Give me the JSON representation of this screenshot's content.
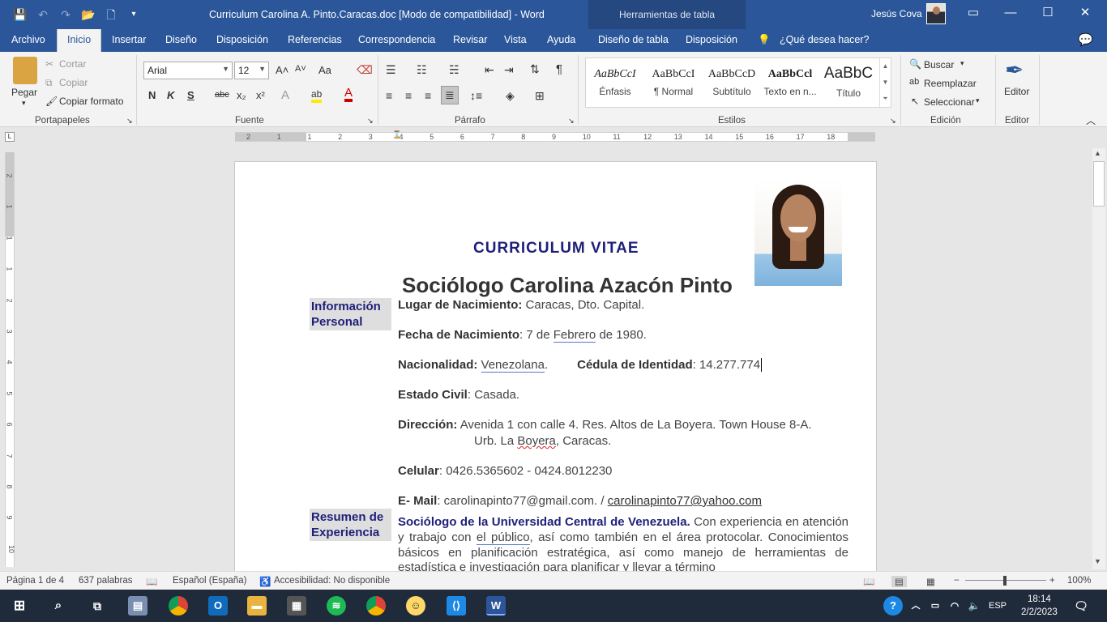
{
  "titlebar": {
    "doc_title": "Curriculum Carolina A. Pinto.Caracas.doc [Modo de compatibilidad]  -  Word",
    "table_tools": "Herramientas de tabla",
    "user": "Jesús Cova",
    "qat": {
      "save": "💾",
      "undo": "↶",
      "redo": "↷",
      "open": "📂",
      "new": "🗋",
      "more": "▾"
    }
  },
  "menu": {
    "tabs": [
      "Archivo",
      "Inicio",
      "Insertar",
      "Diseño",
      "Disposición",
      "Referencias",
      "Correspondencia",
      "Revisar",
      "Vista",
      "Ayuda",
      "Diseño de tabla",
      "Disposición",
      "¿Qué desea hacer?"
    ]
  },
  "ribbon": {
    "clipboard": {
      "label": "Portapapeles",
      "paste": "Pegar",
      "cut": "Cortar",
      "copy": "Copiar",
      "format_painter": "Copiar formato"
    },
    "font": {
      "label": "Fuente",
      "family": "Arial",
      "size": "12",
      "bold": "N",
      "italic": "K",
      "underline": "S",
      "strike": "abc",
      "sub": "x₂",
      "sup": "x²",
      "grow": "A˄",
      "shrink": "A˅",
      "case": "Aa",
      "effects": "A",
      "highlight": "ab",
      "color": "A"
    },
    "paragraph": {
      "label": "Párrafo"
    },
    "styles": {
      "label": "Estilos",
      "items": [
        {
          "sample": "AaBbCcI",
          "name": "Énfasis"
        },
        {
          "sample": "AaBbCcI",
          "name": "¶ Normal"
        },
        {
          "sample": "AaBbCcD",
          "name": "Subtítulo"
        },
        {
          "sample": "AaBbCcl",
          "name": "Texto en n..."
        },
        {
          "sample": "AaBbC",
          "name": "Título"
        }
      ]
    },
    "editing": {
      "label": "Edición",
      "find": "Buscar",
      "replace": "Reemplazar",
      "select": "Seleccionar"
    },
    "editor": {
      "label": "Editor",
      "button": "Editor"
    }
  },
  "ruler": {
    "h_ticks": [
      "2",
      "1",
      "1",
      "2",
      "3",
      "4",
      "5",
      "6",
      "7",
      "8",
      "9",
      "10",
      "11",
      "12",
      "13",
      "14",
      "15",
      "16",
      "17",
      "18"
    ],
    "v_ticks": [
      "2",
      "1",
      "1",
      "1",
      "2",
      "3",
      "4",
      "5",
      "6",
      "7",
      "8",
      "9",
      "10"
    ]
  },
  "document": {
    "cv_title": "CURRICULUM VITAE",
    "name": "Sociólogo Carolina Azacón Pinto",
    "section_personal": "Información Personal",
    "section_summary": "Resumen de Experiencia",
    "birthplace": {
      "label": "Lugar de Nacimiento:",
      "value": " Caracas, Dto. Capital."
    },
    "birthdate": {
      "label": "Fecha de Nacimiento",
      "pre": ": 7 de ",
      "month": "Febrero",
      "post": " de 1980."
    },
    "nationality": {
      "label": "Nacionalidad:",
      "value": "Venezolana",
      "id_label": "Cédula de Identidad",
      "id_value": ": 14.277.774"
    },
    "civil": {
      "label": "Estado Civil",
      "value": ":  Casada."
    },
    "address": {
      "label": "Dirección:",
      "line1": " Avenida 1 con calle 4. Res. Altos de La Boyera. Town House 8-A.",
      "line2_pre": "Urb. La ",
      "line2_word": "Boyera",
      "line2_post": ", Caracas."
    },
    "phone": {
      "label": "Celular",
      "value": ": 0426.5365602    -    0424.8012230"
    },
    "email": {
      "label": "E- Mail",
      "value": ":    carolinapinto77@gmail.com.  / ",
      "link": "carolinapinto77@yahoo.com"
    },
    "summary": {
      "lead": "Sociólogo de la Universidad Central de Venezuela.",
      "t1": " Con experiencia en atención y trabajo con ",
      "link": "el  público",
      "t2": ", así como también en el área protocolar. Conocimientos básicos en planificación estratégica, así como manejo de herramientas de estadística e investigación para planificar y llevar a término"
    }
  },
  "status": {
    "page": "Página 1 de 4",
    "words": "637 palabras",
    "lang": "Español (España)",
    "accessibility": "Accesibilidad: No disponible",
    "zoom": "100%"
  },
  "taskbar": {
    "lang": "ESP",
    "time": "18:14",
    "date": "2/2/2023"
  }
}
